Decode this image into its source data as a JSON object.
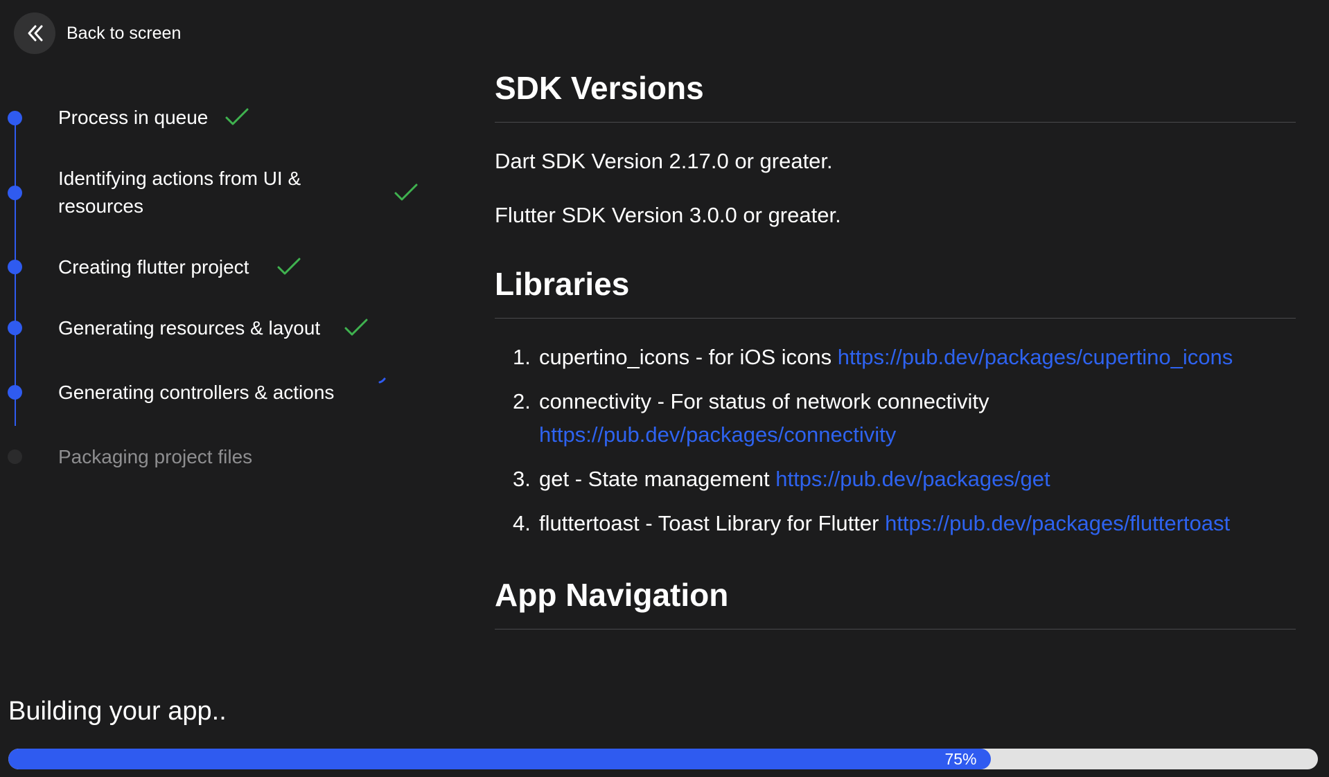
{
  "back": {
    "label": "Back to screen"
  },
  "steps": [
    {
      "label": "Process in queue",
      "status": "done"
    },
    {
      "label": "Identifying actions from UI & resources",
      "status": "done"
    },
    {
      "label": "Creating flutter project",
      "status": "done"
    },
    {
      "label": "Generating resources & layout",
      "status": "done"
    },
    {
      "label": "Generating controllers & actions",
      "status": "in-progress"
    },
    {
      "label": "Packaging project files",
      "status": "pending"
    }
  ],
  "content": {
    "sdk_heading": "SDK Versions",
    "sdk_items": [
      "Dart SDK Version 2.17.0 or greater.",
      "Flutter SDK Version 3.0.0 or greater."
    ],
    "libraries_heading": "Libraries",
    "libraries": [
      {
        "num": "1.",
        "name": "cupertino_icons - for iOS icons",
        "url": "https://pub.dev/packages/cupertino_icons"
      },
      {
        "num": "2.",
        "name": "connectivity - For status of network connectivity",
        "url": "https://pub.dev/packages/connectivity"
      },
      {
        "num": "3.",
        "name": "get - State management",
        "url": "https://pub.dev/packages/get"
      },
      {
        "num": "4.",
        "name": "fluttertoast - Toast Library for Flutter",
        "url": "https://pub.dev/packages/fluttertoast"
      }
    ],
    "nav_heading": "App Navigation"
  },
  "status": {
    "label": "Building your app..",
    "progress_percent": 75,
    "progress_text": "75%"
  },
  "colors": {
    "background": "#1c1c1d",
    "accent": "#2f5bf0",
    "link": "#2e63f0",
    "check": "#3fb24f",
    "track": "#e2e2e2"
  },
  "icons": {
    "back": "double-chevron-left-icon",
    "done": "checkmark-icon",
    "in_progress": "spinner-icon"
  }
}
